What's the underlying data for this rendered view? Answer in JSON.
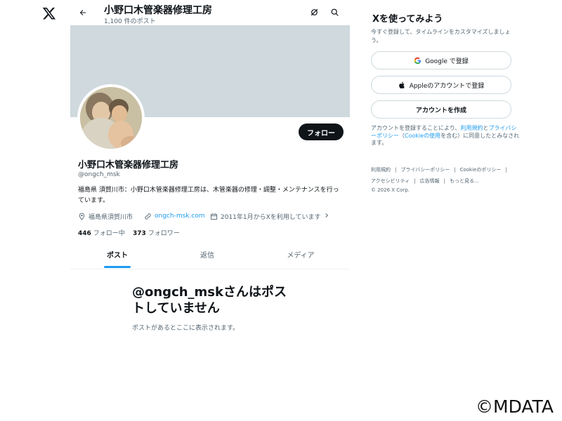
{
  "header": {
    "title": "小野口木管楽器修理工房",
    "post_count": "1,100 件のポスト"
  },
  "profile": {
    "name": "小野口木管楽器修理工房",
    "handle": "@ongch_msk",
    "bio": "福島県 須賀川市：小野口木管楽器修理工房は、木管楽器の修理・調整・メンテナンスを行っています。",
    "location": "福島県須賀川市",
    "website": "ongch-msk.com",
    "joined": "2011年1月からXを利用しています",
    "following_count": "446",
    "following_label": "フォロー中",
    "followers_count": "373",
    "followers_label": "フォロワー",
    "follow_button": "フォロー"
  },
  "tabs": [
    {
      "label": "ポスト",
      "active": true
    },
    {
      "label": "返信",
      "active": false
    },
    {
      "label": "メディア",
      "active": false
    }
  ],
  "empty_state": {
    "title": "@ongch_mskさんはポストしていません",
    "subtitle": "ポストがあるとここに表示されます。"
  },
  "sidebar": {
    "title": "Xを使ってみよう",
    "description": "今すぐ登録して、タイムラインをカスタマイズしましょう。",
    "google_button": "Google で登録",
    "apple_button": "Appleのアカウントで登録",
    "create_button": "アカウントを作成",
    "legal_prefix": "アカウントを登録することにより、",
    "legal_terms": "利用規約",
    "legal_and": "と",
    "legal_privacy": "プライバシーポリシー",
    "legal_cookie_open": "（",
    "legal_cookie": "Cookieの使用",
    "legal_suffix": "を含む）に同意したとみなされます。"
  },
  "footer": {
    "terms": "利用規約",
    "privacy": "プライバシーポリシー",
    "cookie": "Cookieのポリシー",
    "accessibility": "アクセシビリティ",
    "ads": "広告情報",
    "more": "もっと見る…",
    "separator": "|",
    "copyright": "© 2026 X Corp."
  },
  "watermark": "©MDATA",
  "colors": {
    "accent": "#1d9bf0",
    "text": "#0f1419",
    "secondary": "#536471",
    "banner": "#cfd9de",
    "button_dark": "#0f1419"
  },
  "icons": [
    "x-logo-icon",
    "back-arrow-icon",
    "grok-icon",
    "search-icon",
    "location-icon",
    "link-icon",
    "calendar-icon",
    "google-icon",
    "apple-icon"
  ]
}
